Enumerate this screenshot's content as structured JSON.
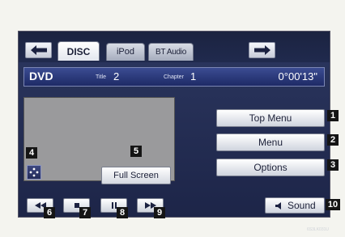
{
  "tabs": [
    {
      "label": "DISC",
      "active": true
    },
    {
      "label": "iPod",
      "active": false
    },
    {
      "label": "BT Audio",
      "active": false
    }
  ],
  "nav": {
    "prev_icon": "arrow-left-icon",
    "next_icon": "arrow-right-icon"
  },
  "info": {
    "source": "DVD",
    "title_label": "Title",
    "title_value": "2",
    "chapter_label": "Chapter",
    "chapter_value": "1",
    "time": "0°00'13\""
  },
  "side_buttons": [
    "Top Menu",
    "Menu",
    "Options"
  ],
  "fullscreen_label": "Full Screen",
  "sound_label": "Sound",
  "callouts": [
    "1",
    "2",
    "3",
    "4",
    "5",
    "6",
    "7",
    "8",
    "9",
    "10"
  ],
  "figure_code": "6S3LK031U",
  "icons": [
    "cursor-dots-icon",
    "rewind-icon",
    "stop-icon",
    "pause-icon",
    "fast-forward-icon",
    "speaker-icon"
  ],
  "colors": {
    "screen": "#1d2548",
    "info_bar": "#2c3a80",
    "button": "#ffffff",
    "callout": "#151515"
  }
}
